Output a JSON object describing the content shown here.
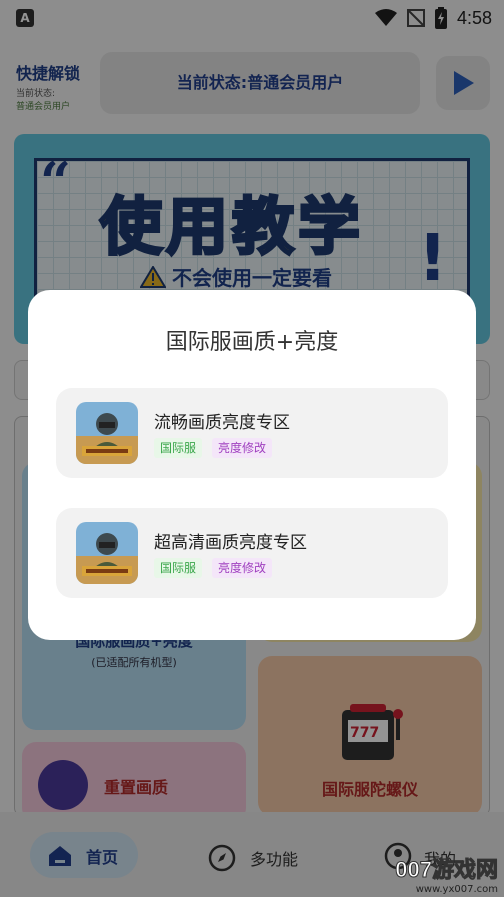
{
  "status_bar": {
    "time": "4:58",
    "left_icon": "A"
  },
  "header": {
    "brand_title": "快捷解锁",
    "brand_sub_label": "当前状态:",
    "brand_sub_value": "普通会员用户",
    "status_text": "当前状态:普通会员用户",
    "play_icon": "play-icon"
  },
  "banner": {
    "title": "使用教学",
    "subtitle": "不会使用一定要看",
    "quote_mark": "“",
    "bang": "!"
  },
  "cards": {
    "blue_line": "国际服画质+亮度",
    "blue_sub": "(已适配所有机型)",
    "orange_label": "国际服陀螺仪",
    "pink_label": "重置画质"
  },
  "dialog": {
    "title": "国际服画质+亮度",
    "items": [
      {
        "name": "流畅画质亮度专区",
        "tag1": "国际服",
        "tag2": "亮度修改"
      },
      {
        "name": "超高清画质亮度专区",
        "tag1": "国际服",
        "tag2": "亮度修改"
      }
    ]
  },
  "nav": {
    "home": "首页",
    "multi": "多功能",
    "mine": "我的"
  },
  "watermark": {
    "main": "007游戏网",
    "url": "www.yx007.com"
  }
}
